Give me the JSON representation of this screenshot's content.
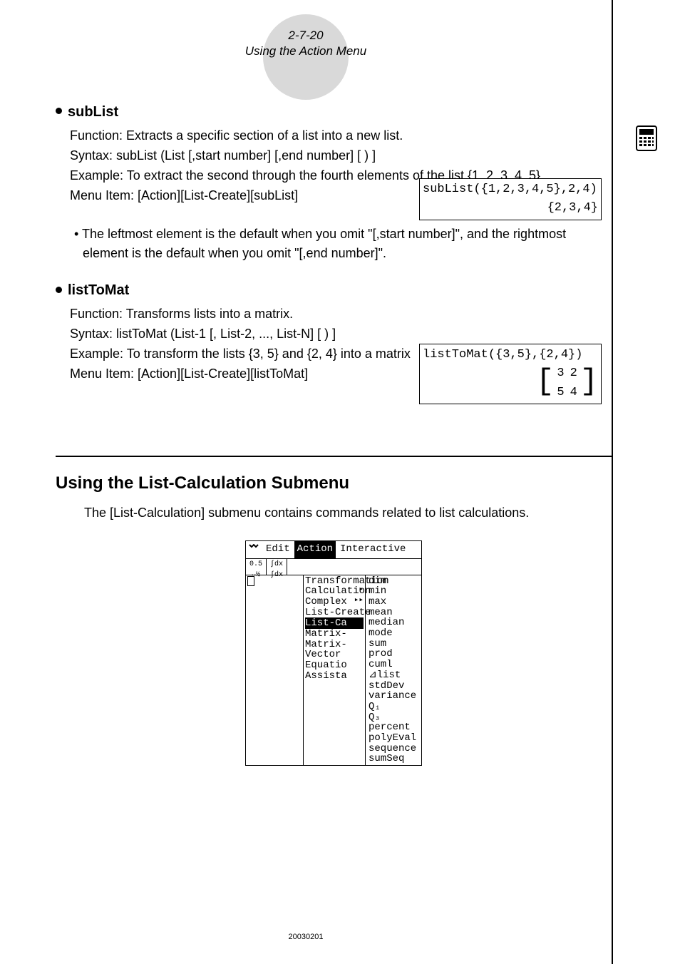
{
  "header": {
    "page_ref": "2-7-20",
    "title": "Using the Action Menu"
  },
  "sections": [
    {
      "name": "subList",
      "function": "Function: Extracts a specific section of a list into a new list.",
      "syntax": "Syntax: subList (List [,start number] [,end number] [ ) ]",
      "example": "Example: To extract the second through the fourth elements of the list {1, 2, 3, 4, 5}",
      "menu_item": "Menu Item: [Action][List-Create][subList]",
      "calc_input": "subList({1,2,3,4,5},2,4)",
      "calc_output": "{2,3,4}",
      "note": "• The leftmost element is the default when you omit \"[,start number]\", and the rightmost element is the default when you omit \"[,end number]\"."
    },
    {
      "name": "listToMat",
      "function": "Function: Transforms lists into a matrix.",
      "syntax": "Syntax: listToMat (List-1 [, List-2, ..., List-N] [ ) ]",
      "example": "Example: To transform the lists {3, 5} and {2, 4} into a matrix",
      "menu_item": "Menu Item: [Action][List-Create][listToMat]",
      "calc_input": "listToMat({3,5},{2,4})",
      "matrix": [
        [
          "3",
          "2"
        ],
        [
          "5",
          "4"
        ]
      ]
    }
  ],
  "subsection": {
    "heading": "Using the List-Calculation Submenu",
    "description": "The [List-Calculation] submenu contains commands related to list calculations."
  },
  "calc_menu": {
    "menubar": [
      "Edit",
      "Action",
      "Interactive"
    ],
    "highlighted_menubar_index": 1,
    "col_mid": [
      "Transformation",
      "Calculation",
      "Complex",
      "List-Create",
      "List-Ca",
      "Matrix-",
      "Matrix-",
      "Vector",
      "Equatio",
      "Assista"
    ],
    "mid_highlight_index": 4,
    "col_right": [
      "dim",
      "min",
      "max",
      "mean",
      "median",
      "mode",
      "sum",
      "prod",
      "cuml",
      "⊿list",
      "stdDev",
      "variance",
      "Q₁",
      "Q₃",
      "percent",
      "polyEval",
      "sequence",
      "sumSeq"
    ]
  },
  "footer": "20030201"
}
